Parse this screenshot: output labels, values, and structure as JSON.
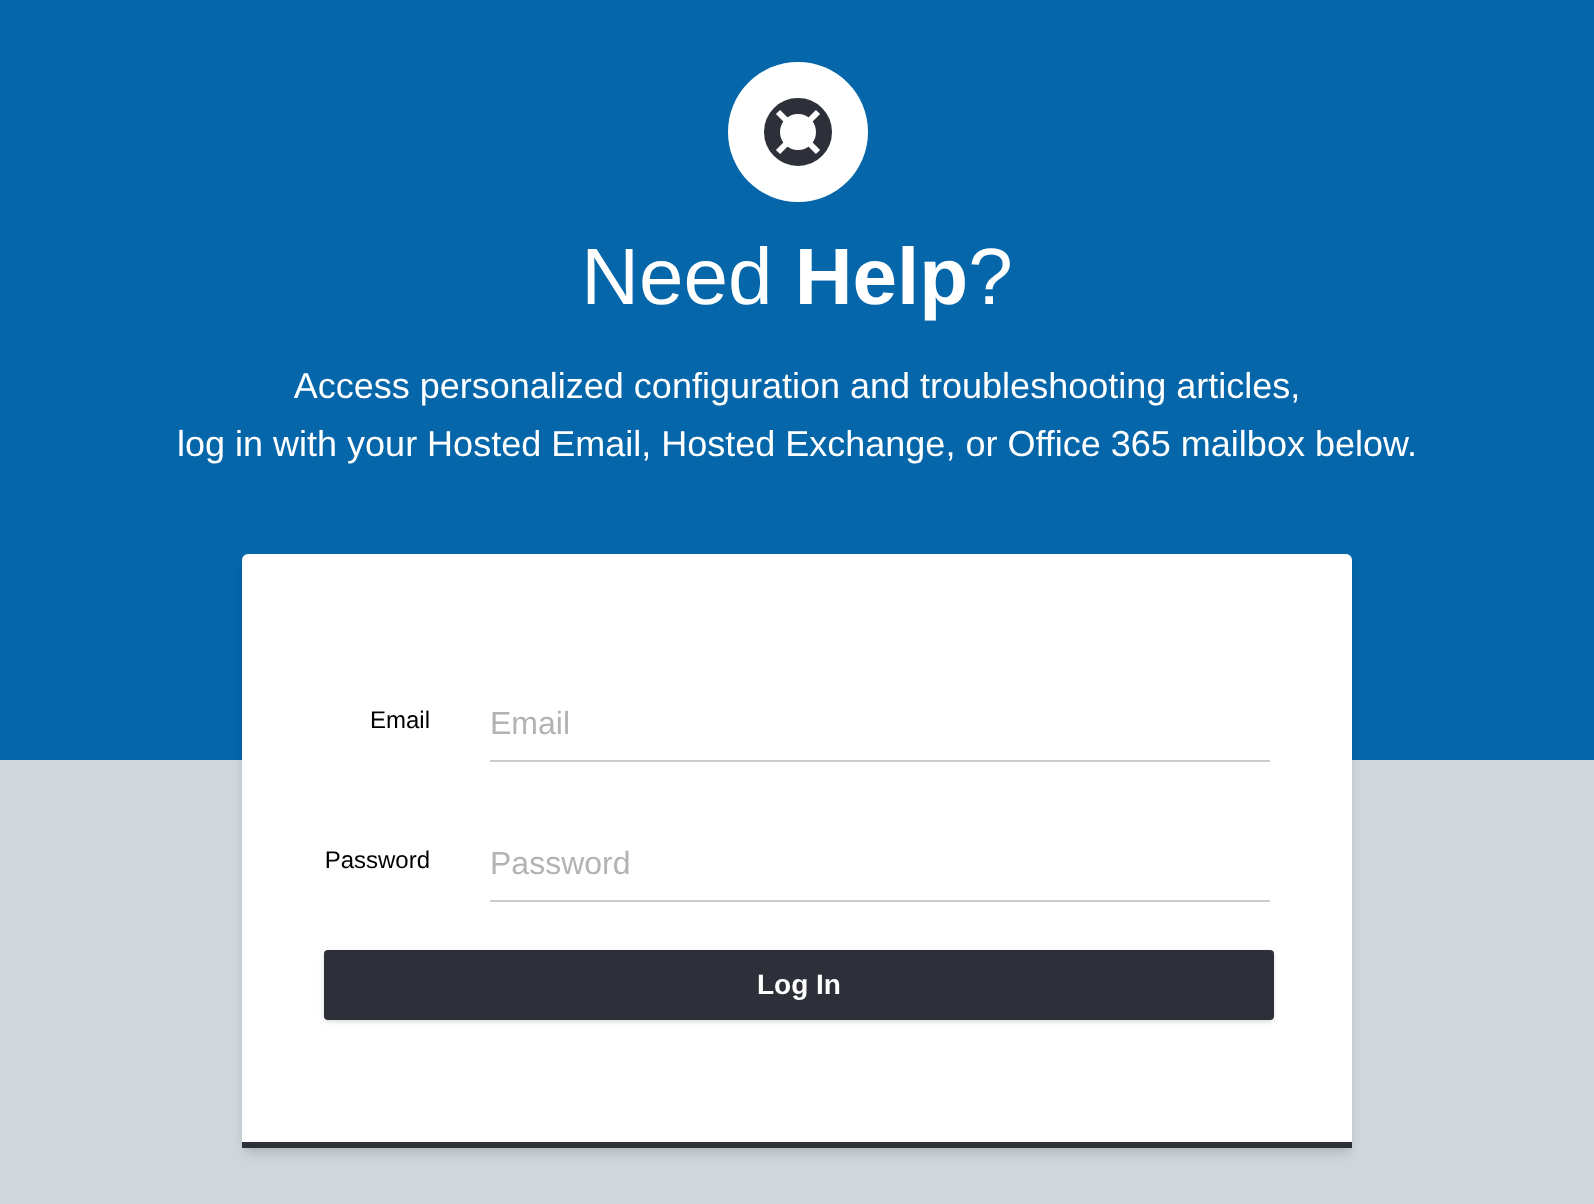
{
  "header": {
    "title": "Need **Help**?",
    "subtitle_lines": [
      "Access personalized configuration and troubleshooting articles,",
      "log in with your Hosted Email, Hosted Exchange, or Office 365 mailbox below."
    ]
  },
  "form": {
    "fields": [
      {
        "label": "Email",
        "placeholder": "Email"
      },
      {
        "label": "Password",
        "placeholder": "Password"
      }
    ],
    "submit": "Log In"
  }
}
